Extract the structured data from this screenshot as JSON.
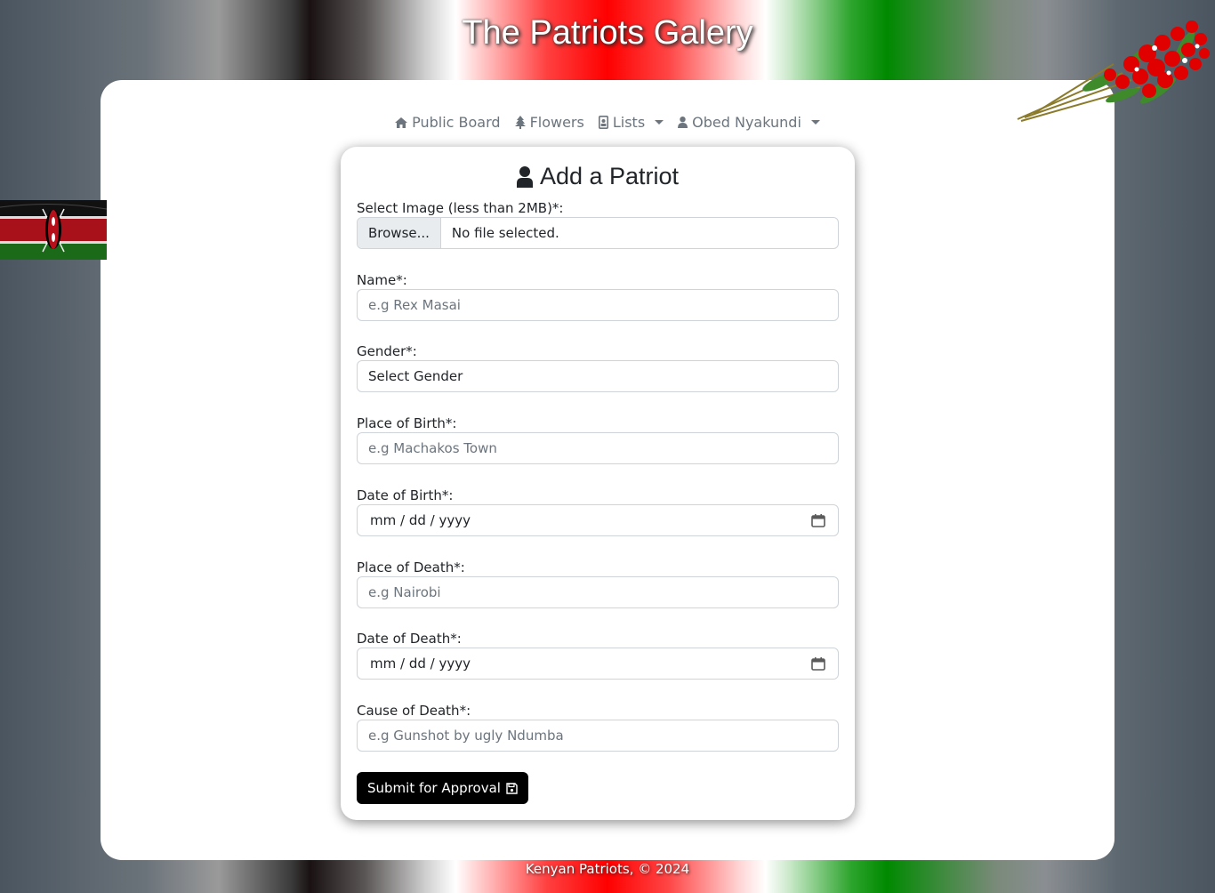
{
  "header": {
    "title": "The Patriots Galery"
  },
  "nav": {
    "items": [
      {
        "label": "Public Board",
        "icon": "home-icon",
        "dropdown": false
      },
      {
        "label": "Flowers",
        "icon": "tree-icon",
        "dropdown": false
      },
      {
        "label": "Lists",
        "icon": "contact-card-icon",
        "dropdown": true
      },
      {
        "label": "Obed Nyakundi",
        "icon": "user-icon",
        "dropdown": true
      }
    ]
  },
  "form": {
    "title": "Add a Patriot",
    "title_icon": "user-icon",
    "image": {
      "label": "Select Image (less than 2MB)*:",
      "button": "Browse...",
      "status": "No file selected."
    },
    "name": {
      "label": "Name*:",
      "placeholder": "e.g Rex Masai"
    },
    "gender": {
      "label": "Gender*:",
      "value": "Select Gender"
    },
    "place_of_birth": {
      "label": "Place of Birth*:",
      "placeholder": "e.g Machakos Town"
    },
    "date_of_birth": {
      "label": "Date of Birth*:",
      "placeholder": "mm / dd / yyyy"
    },
    "place_of_death": {
      "label": "Place of Death*:",
      "placeholder": "e.g Nairobi"
    },
    "date_of_death": {
      "label": "Date of Death*:",
      "placeholder": "mm / dd / yyyy"
    },
    "cause_of_death": {
      "label": "Cause of Death*:",
      "placeholder": "e.g Gunshot by ugly Ndumba"
    },
    "submit": {
      "label": "Submit for Approval",
      "icon": "save-icon"
    }
  },
  "footer": {
    "text": "Kenyan Patriots, © 2024"
  },
  "colors": {
    "kenya_black": "#000000",
    "kenya_red": "#bb0000",
    "kenya_green": "#006600",
    "submit_bg": "#000000"
  }
}
